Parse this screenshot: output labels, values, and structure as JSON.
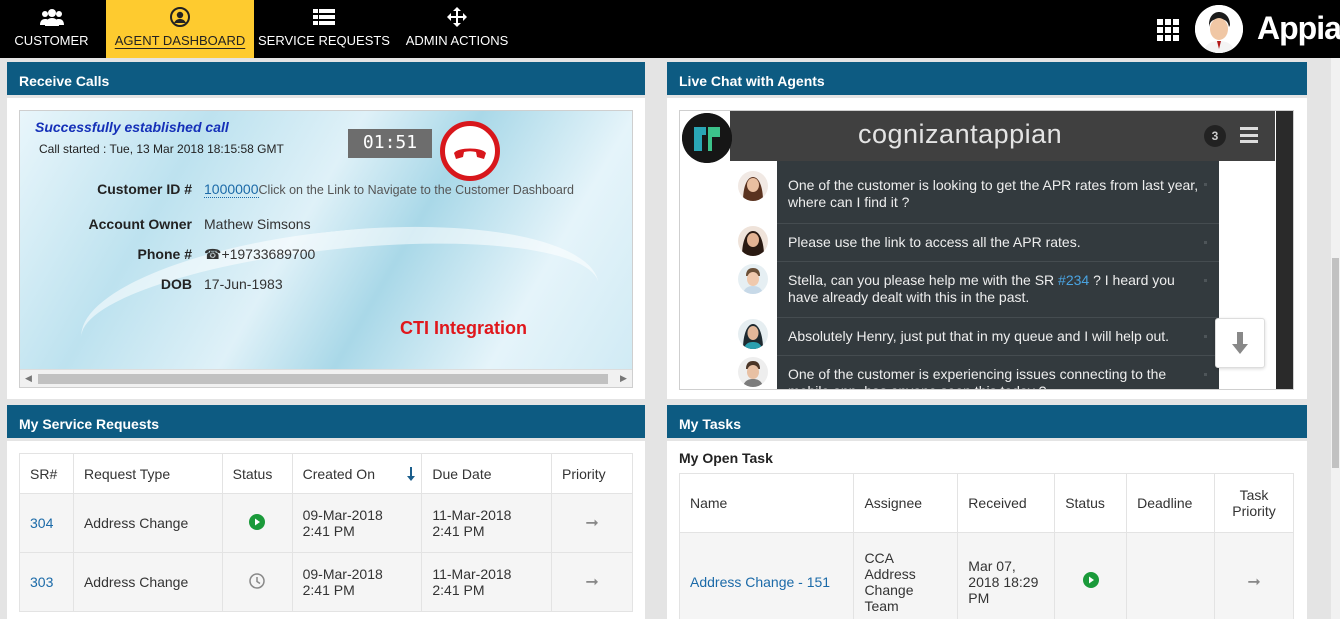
{
  "nav": {
    "items": [
      {
        "label": "CUSTOMER",
        "icon": "users-icon"
      },
      {
        "label": "AGENT DASHBOARD",
        "icon": "user-circle-icon",
        "active": true
      },
      {
        "label": "SERVICE REQUESTS",
        "icon": "list-icon"
      },
      {
        "label": "ADMIN ACTIONS",
        "icon": "move-arrows-icon"
      }
    ],
    "brand": "Appian"
  },
  "receive_calls": {
    "title": "Receive Calls",
    "status": "Successfully established call",
    "call_started": "Call started : Tue, 13 Mar 2018 18:15:58 GMT",
    "timer": "01:51",
    "customer_id_label": "Customer ID #",
    "customer_id": "1000000",
    "customer_id_hint": "Click on the Link to Navigate to the Customer Dashboard",
    "account_owner_label": "Account Owner",
    "account_owner": "Mathew Simsons",
    "phone_label": "Phone #",
    "phone": "☎+19733689700",
    "dob_label": "DOB",
    "dob": "17-Jun-1983",
    "cti_label": "CTI Integration"
  },
  "live_chat": {
    "title": "Live Chat with Agents",
    "chat_title": "cognizantappian",
    "badge": "3",
    "messages": [
      {
        "text": "One of the customer is looking to get the APR rates from last year, where can I find it ?"
      },
      {
        "text": "Please use the link to access all the APR rates."
      },
      {
        "text_before": "Stella, can you please help me with the SR ",
        "link": "#234",
        "text_after": " ? I heard you have already dealt with this in the past."
      },
      {
        "text": "Absolutely Henry, just put that in my queue and I will help out."
      },
      {
        "text": "One of the customer is experiencing issues connecting to the mobile app, has anyone seen this today ?"
      }
    ]
  },
  "service_requests": {
    "title": "My Service Requests",
    "columns": [
      "SR#",
      "Request Type",
      "Status",
      "Created On",
      "Due Date",
      "Priority"
    ],
    "rows": [
      {
        "sr": "304",
        "type": "Address Change",
        "status_icon": "play-icon",
        "created": "09-Mar-2018",
        "created_time": "2:41 PM",
        "due": "11-Mar-2018",
        "due_time": "2:41 PM",
        "priority_icon": "arrow-right-icon"
      },
      {
        "sr": "303",
        "type": "Address Change",
        "status_icon": "clock-icon",
        "created": "09-Mar-2018",
        "created_time": "2:41 PM",
        "due": "11-Mar-2018",
        "due_time": "2:41 PM",
        "priority_icon": "arrow-right-icon"
      }
    ]
  },
  "tasks": {
    "title": "My Tasks",
    "subtitle": "My Open Task",
    "columns": [
      "Name",
      "Assignee",
      "Received",
      "Status",
      "Deadline",
      "Task Priority"
    ],
    "rows": [
      {
        "name": "Address Change - 151",
        "assignee": "CCA Address Change Team",
        "received": "Mar 07, 2018 18:29 PM",
        "status_icon": "play-icon",
        "deadline": "",
        "priority_icon": "arrow-right-icon"
      }
    ]
  },
  "colors": {
    "header_blue": "#0d5b82",
    "nav_active": "#fecb2f",
    "link": "#1b6aa8",
    "hangup_red": "#d8171c",
    "status_green": "#1a9a3a"
  }
}
